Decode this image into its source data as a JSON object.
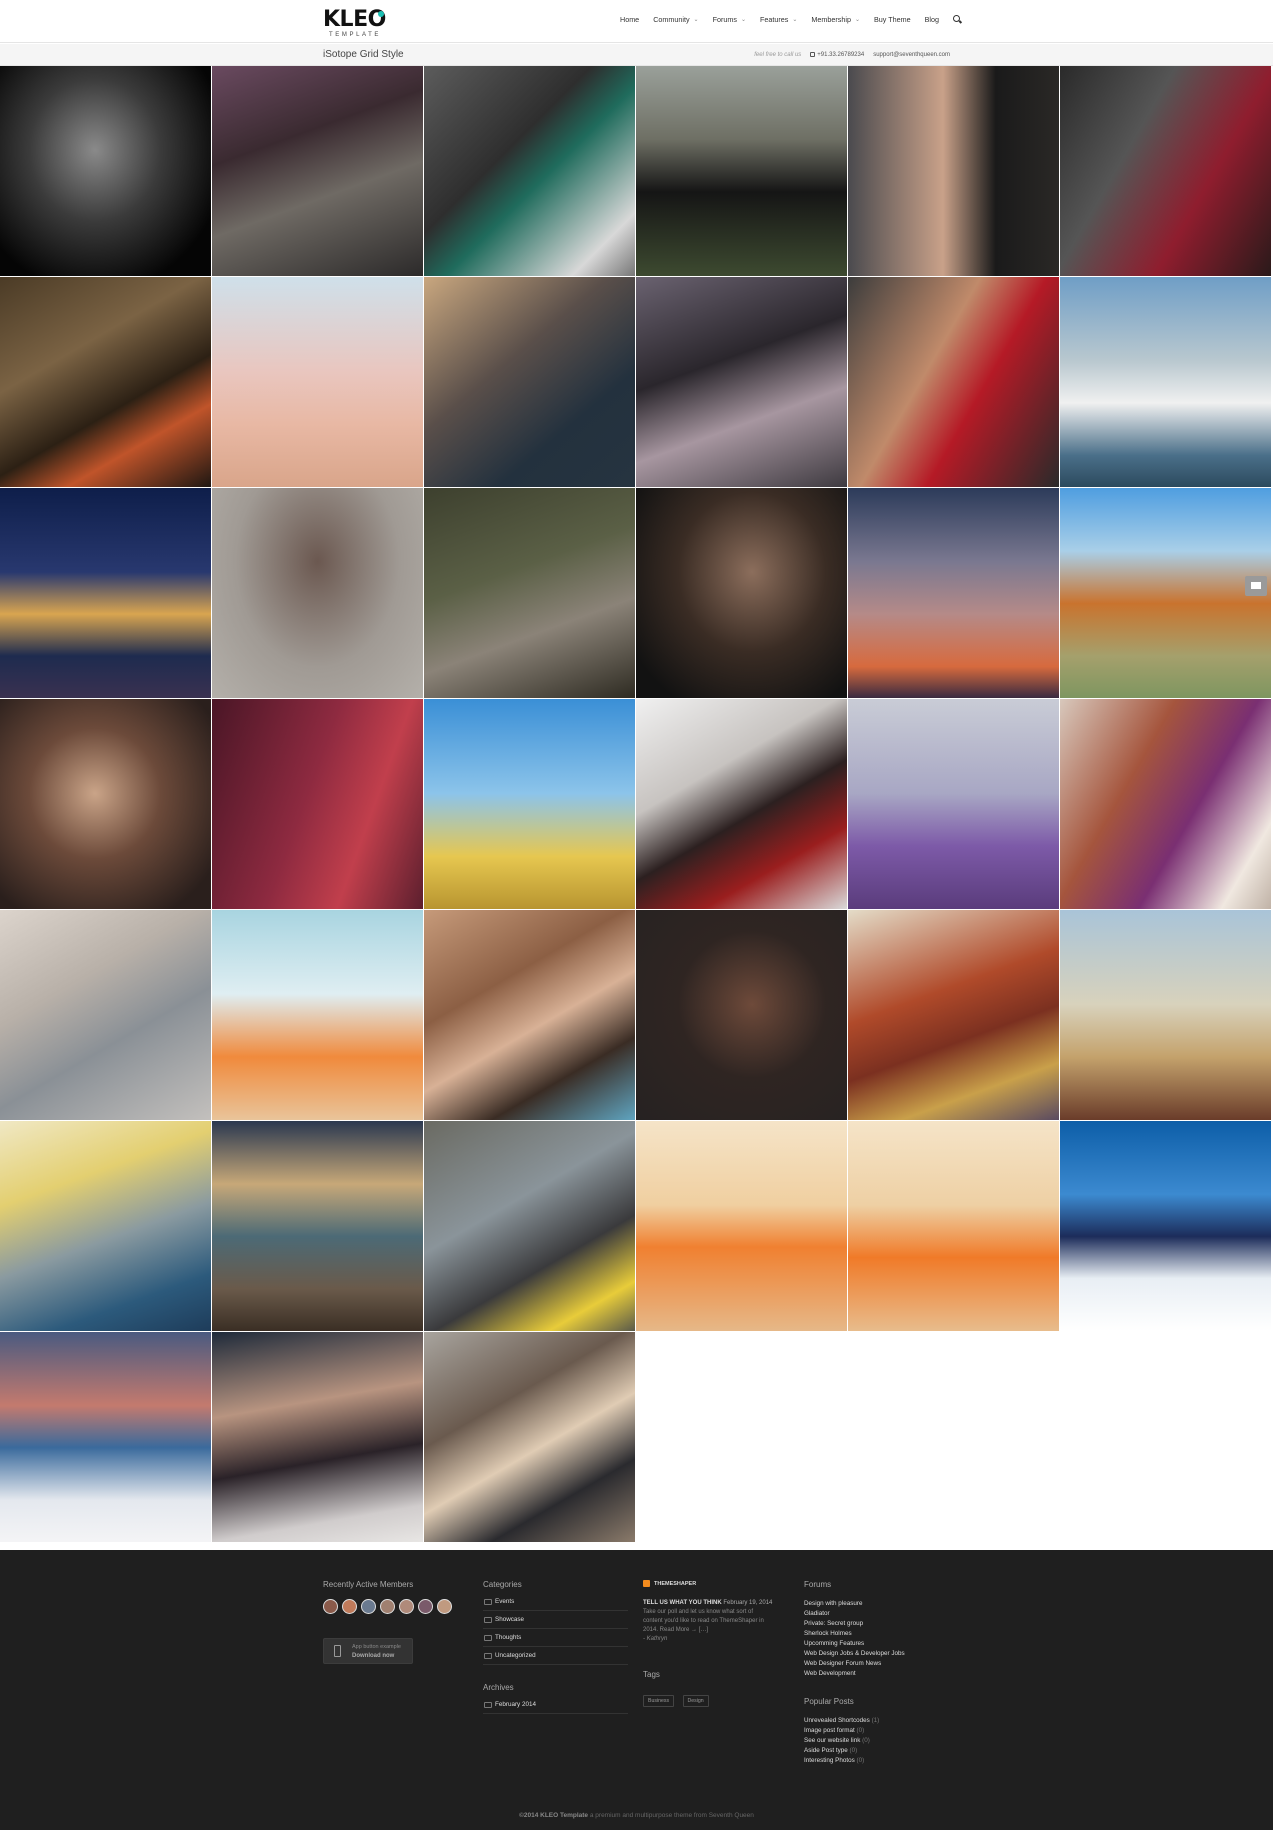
{
  "header": {
    "logo": "KLEO",
    "logo_sub": "TEMPLATE",
    "nav": [
      {
        "label": "Home",
        "dropdown": false
      },
      {
        "label": "Community",
        "dropdown": true
      },
      {
        "label": "Forums",
        "dropdown": true
      },
      {
        "label": "Features",
        "dropdown": true
      },
      {
        "label": "Membership",
        "dropdown": true
      },
      {
        "label": "Buy Theme",
        "dropdown": false
      },
      {
        "label": "Blog",
        "dropdown": false
      }
    ],
    "search_icon": "search-icon"
  },
  "titlebar": {
    "title": "iSotope Grid Style",
    "note": "feel free to call us",
    "phone": "+91.33.26789234",
    "email": "support@seventhqueen.com"
  },
  "colors": {
    "accent": "#1bbfb3",
    "footer_bg": "#1f1f1f",
    "titlebar_bg": "#f5f5f5"
  },
  "footer": {
    "members_title": "Recently Active Members",
    "members_count": 7,
    "app_button": {
      "line1": "App button example",
      "line2": "Download now"
    },
    "categories_title": "Categories",
    "categories": [
      "Events",
      "Showcase",
      "Thoughts",
      "Uncategorized"
    ],
    "archives_title": "Archives",
    "archives": [
      "February 2014"
    ],
    "feed": {
      "source": "THEMESHAPER",
      "headline": "TELL US WHAT YOU THINK",
      "date": "February 19, 2014",
      "body": "Take our poll and let us know what sort of content you'd like to read on ThemeShaper in 2014. Read More → […]",
      "author": "- Kathryn"
    },
    "tags_title": "Tags",
    "tags": [
      "Business",
      "Design"
    ],
    "forums_title": "Forums",
    "forums": [
      "Design with pleasure",
      "Gladiator",
      "Private: Secret group",
      "Sherlock Holmes",
      "Upcomming Features",
      "Web Design Jobs & Developer Jobs",
      "Web Designer Forum News",
      "Web Development"
    ],
    "popular_title": "Popular Posts",
    "popular": [
      {
        "title": "Unrevealed Shortcodes",
        "count": "(1)"
      },
      {
        "title": "Image post format",
        "count": "(0)"
      },
      {
        "title": "See our website link",
        "count": "(0)"
      },
      {
        "title": "Aside Post type",
        "count": "(0)"
      },
      {
        "title": "Interesting Photos",
        "count": "(0)"
      }
    ],
    "copyright_brand": "©2014 KLEO Template",
    "copyright_rest": " a premium and multipurpose theme from Seventh Queen"
  }
}
